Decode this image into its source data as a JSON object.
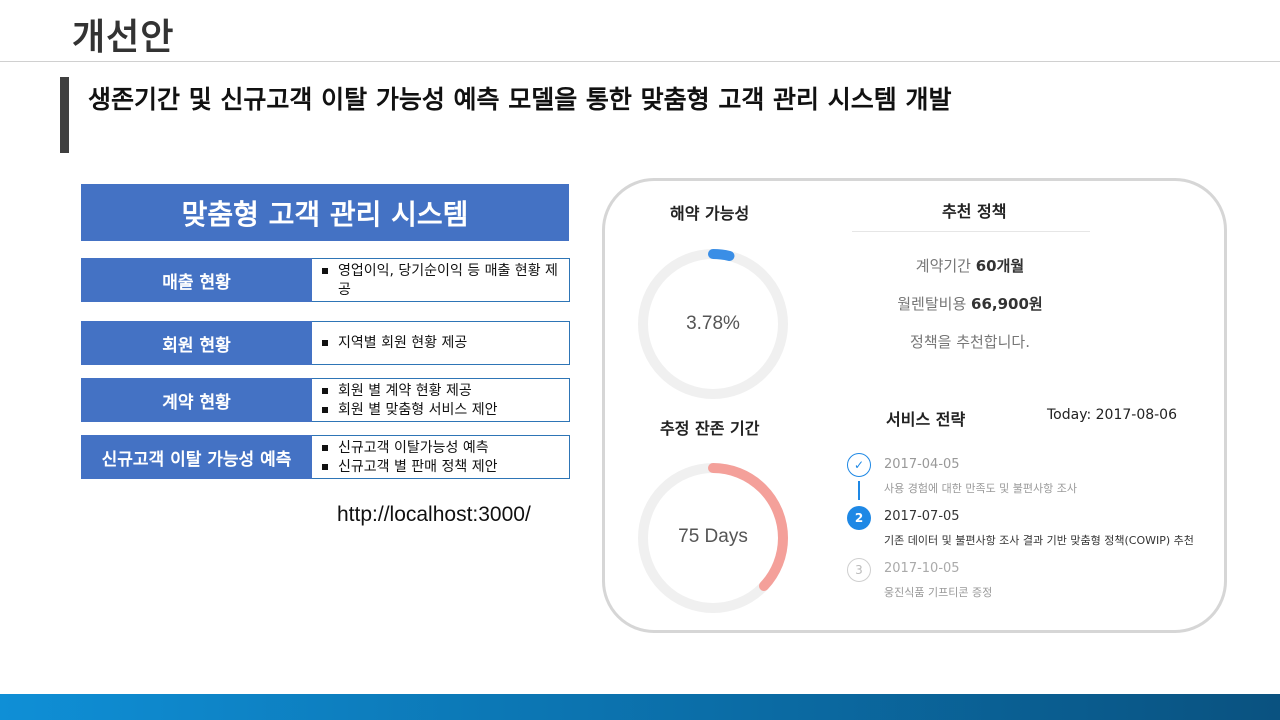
{
  "slide": {
    "title": "개선안",
    "subtitle": "생존기간 및 신규고객 이탈 가능성 예측 모델을 통한 맞춤형 고객 관리 시스템 개발"
  },
  "system": {
    "header": "맞춤형 고객 관리 시스템",
    "features": [
      {
        "label": "매출 현황",
        "items": [
          "영업이익, 당기순이익 등 매출 현황 제공"
        ]
      },
      {
        "label": "회원 현황",
        "items": [
          "지역별 회원 현황 제공"
        ]
      },
      {
        "label": "계약 현황",
        "items": [
          "회원 별 계약 현황 제공",
          "회원 별 맞춤형 서비스 제안"
        ]
      },
      {
        "label": "신규고객 이탈 가능성 예측",
        "items": [
          "신규고객 이탈가능성 예측",
          "신규고객 별 판매 정책 제안"
        ]
      }
    ],
    "url": "http://localhost:3000/"
  },
  "dashboard": {
    "churn": {
      "title": "해약 가능성",
      "value_text": "3.78%",
      "fraction": 0.0378,
      "color": "#3a8ee6",
      "track_color": "#f0f0f0"
    },
    "survival": {
      "title": "추정 잔존 기간",
      "value_text": "75 Days",
      "fraction": 0.37,
      "color": "#f4a09a",
      "track_color": "#f0f0f0"
    },
    "recommendation": {
      "title": "추천 정책",
      "period_label": "계약기간",
      "period_value": "60개월",
      "fee_label": "월렌탈비용",
      "fee_value": "66,900원",
      "message": "정책을 추천합니다."
    },
    "strategy": {
      "title": "서비스 전략",
      "today": "Today: 2017-08-06",
      "steps": [
        {
          "marker": "✓",
          "date": "2017-04-05",
          "desc": "사용 경험에 대한 만족도 및 불편사항 조사",
          "status": "done"
        },
        {
          "marker": "2",
          "date": "2017-07-05",
          "desc": "기존 데이터 및 불편사항 조사 결과 기반 맞춤형 정책(COWIP) 추천",
          "status": "current"
        },
        {
          "marker": "3",
          "date": "2017-10-05",
          "desc": "웅진식품 기프티콘 증정",
          "status": "upcoming"
        }
      ]
    }
  },
  "colors": {
    "feature_blue": "#4472c4",
    "accent_blue": "#1e88e5",
    "footer_blue": "#0b6ea8"
  }
}
